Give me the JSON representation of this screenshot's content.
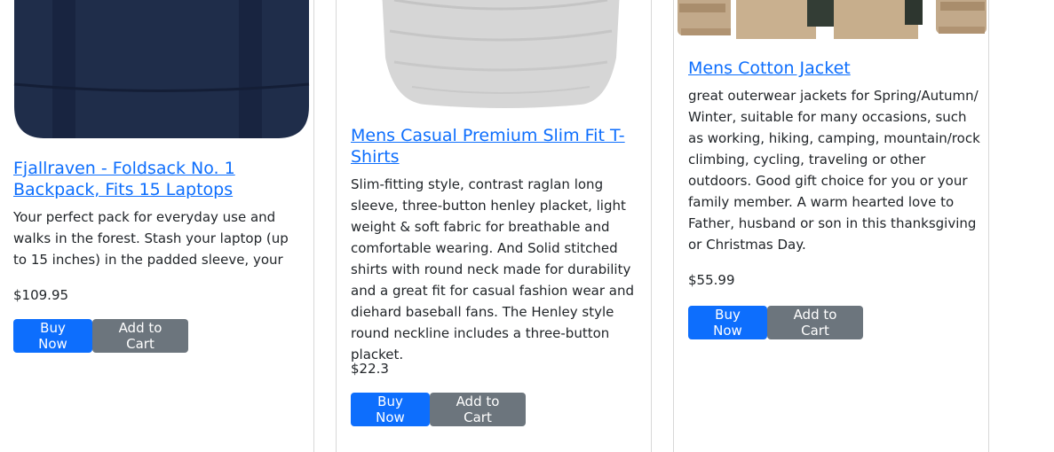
{
  "products": [
    {
      "title": "Fjallraven - Foldsack No. 1 Backpack, Fits 15 Laptops",
      "description": "Your perfect pack for everyday use and walks in the forest. Stash your laptop (up to 15 inches) in the padded sleeve, your everyday",
      "price": "$109.95",
      "buy_label": "Buy Now",
      "cart_label": "Add to Cart",
      "image_icon": "backpack-image"
    },
    {
      "title": "Mens Casual Premium Slim Fit T-Shirts",
      "description": "Slim-fitting style, contrast raglan long sleeve, three-button henley placket, light weight & soft fabric for breathable and comfortable wearing. And Solid stitched shirts with round neck made for durability and a great fit for casual fashion wear and diehard baseball fans. The Henley style round neckline includes a three-button placket.",
      "price": "$22.3",
      "buy_label": "Buy Now",
      "cart_label": "Add to Cart",
      "image_icon": "tshirt-image"
    },
    {
      "title": "Mens Cotton Jacket",
      "description": "great outerwear jackets for Spring/Autumn/ Winter, suitable for many occasions, such as working, hiking, camping, mountain/rock climbing, cycling, traveling or other outdoors. Good gift choice for you or your family member. A warm hearted love to Father, husband or son in this thanksgiving or Christmas Day.",
      "price": "$55.99",
      "buy_label": "Buy Now",
      "cart_label": "Add to Cart",
      "image_icon": "jacket-image"
    }
  ],
  "colors": {
    "link": "#0d6efd",
    "buy_button": "#0d6efd",
    "cart_button": "#6c757d",
    "text": "#212529"
  }
}
